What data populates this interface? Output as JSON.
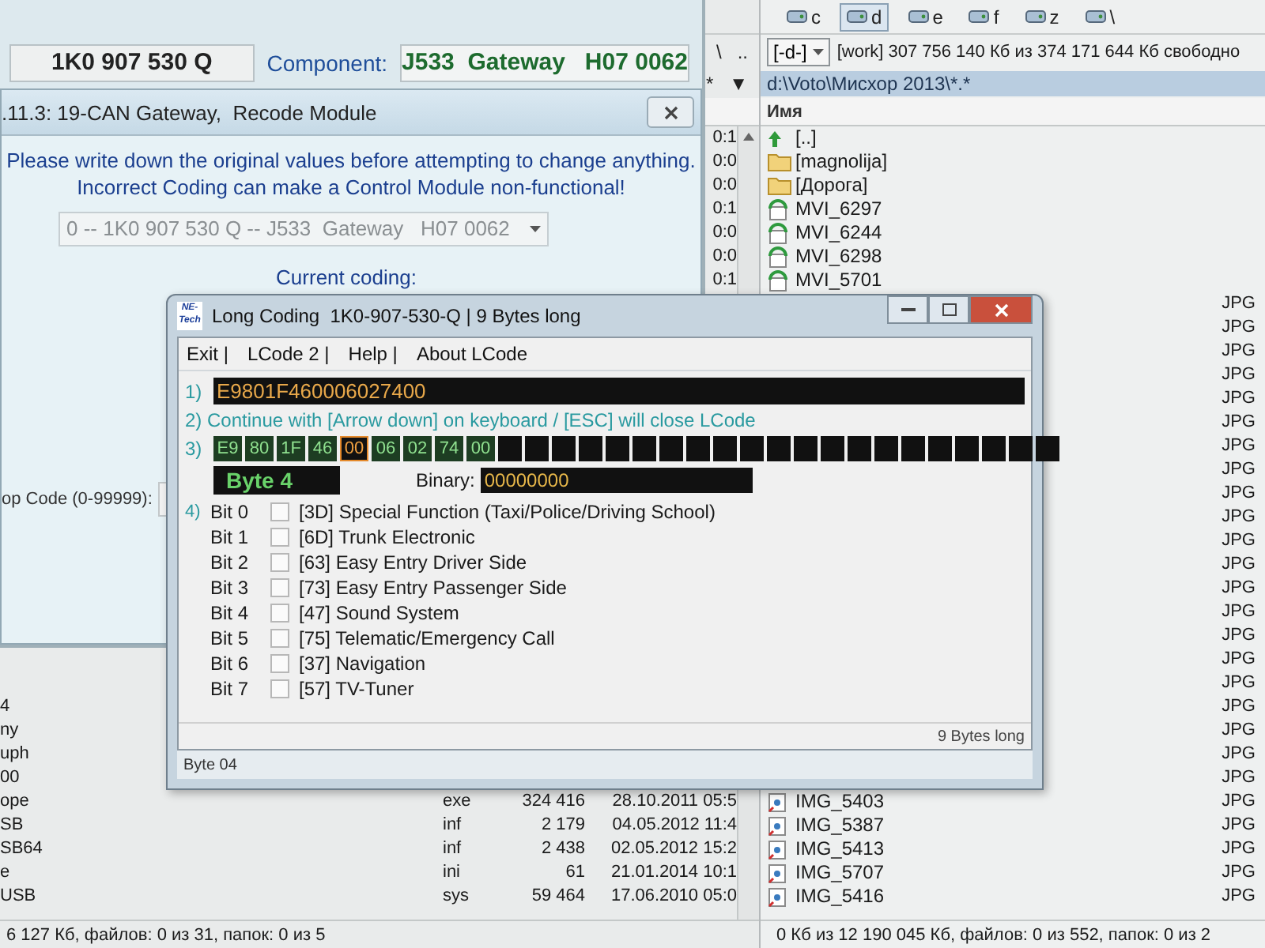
{
  "tc": {
    "left_panel": {
      "path_buttons": [
        "\\",
        ".."
      ],
      "filter_buttons": [
        "*",
        "▼"
      ],
      "date_tails": [
        "0:1",
        "0:0",
        "0:0",
        "0:1",
        "0:0",
        "0:0",
        "0:1"
      ],
      "rows": [
        {
          "name": "4"
        },
        {
          "name": "ny"
        },
        {
          "name": "uph"
        },
        {
          "name": "00"
        },
        {
          "name": "ope",
          "ext": "exe",
          "size": "324 416",
          "date": "28.10.2011 05:5"
        },
        {
          "name": "SB",
          "ext": "inf",
          "size": "2 179",
          "date": "04.05.2012 11:4"
        },
        {
          "name": "SB64",
          "ext": "inf",
          "size": "2 438",
          "date": "02.05.2012 15:2"
        },
        {
          "name": "e",
          "ext": "ini",
          "size": "61",
          "date": "21.01.2014 10:1"
        },
        {
          "name": "USB",
          "ext": "sys",
          "size": "59 464",
          "date": "17.06.2010 05:0"
        }
      ],
      "status": "6 127 Кб, файлов: 0 из 31, папок: 0 из 5"
    },
    "right_panel": {
      "drives": [
        {
          "label": "c",
          "selected": false
        },
        {
          "label": "d",
          "selected": true
        },
        {
          "label": "e",
          "selected": false
        },
        {
          "label": "f",
          "selected": false
        },
        {
          "label": "z",
          "selected": false
        },
        {
          "label": "\\",
          "selected": false
        }
      ],
      "drive_combo": "[-d-]",
      "volume_info": "[work]  307 756 140 Кб из 374 171 644 Кб свободно",
      "path": "d:\\Voto\\Мисхор 2013\\*.*",
      "column_header": "Имя",
      "rows": [
        {
          "kind": "up",
          "name": "[..]"
        },
        {
          "kind": "folder",
          "name": "[magnolija]"
        },
        {
          "kind": "folder",
          "name": "[Дорога]"
        },
        {
          "kind": "video",
          "name": "MVI_6297"
        },
        {
          "kind": "video",
          "name": "MVI_6244"
        },
        {
          "kind": "video",
          "name": "MVI_6298"
        },
        {
          "kind": "video",
          "name": "MVI_5701"
        },
        {
          "ext": "JPG"
        },
        {
          "ext": "JPG"
        },
        {
          "ext": "JPG"
        },
        {
          "ext": "JPG"
        },
        {
          "ext": "JPG"
        },
        {
          "ext": "JPG"
        },
        {
          "ext": "JPG"
        },
        {
          "ext": "JPG"
        },
        {
          "ext": "JPG"
        },
        {
          "ext": "JPG"
        },
        {
          "ext": "JPG"
        },
        {
          "ext": "JPG"
        },
        {
          "ext": "JPG"
        },
        {
          "ext": "JPG"
        },
        {
          "ext": "JPG"
        },
        {
          "ext": "JPG"
        },
        {
          "ext": "JPG"
        },
        {
          "ext": "JPG"
        },
        {
          "ext": "JPG"
        },
        {
          "ext": "JPG"
        },
        {
          "ext": "JPG"
        },
        {
          "kind": "image",
          "name": "IMG_5403",
          "ext": "JPG"
        },
        {
          "kind": "image",
          "name": "IMG_5387",
          "ext": "JPG"
        },
        {
          "kind": "image",
          "name": "IMG_5413",
          "ext": "JPG"
        },
        {
          "kind": "image",
          "name": "IMG_5707",
          "ext": "JPG"
        },
        {
          "kind": "image",
          "name": "IMG_5416",
          "ext": "JPG"
        }
      ],
      "status": "0 Кб из 12 190 045 Кб, файлов: 0 из 552, папок: 0 из 2"
    }
  },
  "vcds": {
    "part_number": "1K0 907 530 Q",
    "component_label": "Component:",
    "component": "J533  Gateway   H07 0062",
    "recode_window": {
      "title": ".11.3: 19-CAN Gateway,  Recode Module",
      "warning_lines": [
        "Please write down the original values before attempting to change anything.",
        "Incorrect Coding can make a Control Module non-functional!"
      ],
      "module_dropdown": "0 -- 1K0 907 530 Q -- J533  Gateway   H07 0062",
      "current_coding_label": "Current coding:",
      "workshop_code_label": "op Code (0-99999):"
    }
  },
  "long_coding": {
    "logo_text": "NE-Tech",
    "title": "Long Coding  1K0-907-530-Q | 9 Bytes long",
    "menu": [
      "Exit |",
      "LCode 2 |",
      "Help |",
      "About LCode"
    ],
    "step1_label": "1)",
    "coding_string": "E9801F460006027400",
    "step2_text": "2) Continue with [Arrow down] on keyboard / [ESC] will close LCode",
    "step3_label": "3)",
    "bytes": [
      {
        "value": "E9",
        "selected": false
      },
      {
        "value": "80",
        "selected": false
      },
      {
        "value": "1F",
        "selected": false
      },
      {
        "value": "46",
        "selected": false
      },
      {
        "value": "00",
        "selected": true
      },
      {
        "value": "06",
        "selected": false
      },
      {
        "value": "02",
        "selected": false
      },
      {
        "value": "74",
        "selected": false
      },
      {
        "value": "00",
        "selected": false
      }
    ],
    "byte_label": "Byte 4",
    "binary_label": "Binary:",
    "binary_value": "00000000",
    "step4_label": "4)",
    "bits": [
      {
        "label": "Bit 0",
        "checked": false,
        "text": "[3D] Special Function (Taxi/Police/Driving School)"
      },
      {
        "label": "Bit 1",
        "checked": false,
        "text": "[6D] Trunk Electronic"
      },
      {
        "label": "Bit 2",
        "checked": false,
        "text": "[63] Easy Entry Driver Side"
      },
      {
        "label": "Bit 3",
        "checked": false,
        "text": "[73] Easy Entry Passenger Side"
      },
      {
        "label": "Bit 4",
        "checked": false,
        "text": "[47] Sound System"
      },
      {
        "label": "Bit 5",
        "checked": false,
        "text": "[75] Telematic/Emergency Call"
      },
      {
        "label": "Bit 6",
        "checked": false,
        "text": "[37] Navigation"
      },
      {
        "label": "Bit 7",
        "checked": false,
        "text": "[57] TV-Tuner"
      }
    ],
    "length_note": "9 Bytes long",
    "status": "Byte 04"
  }
}
